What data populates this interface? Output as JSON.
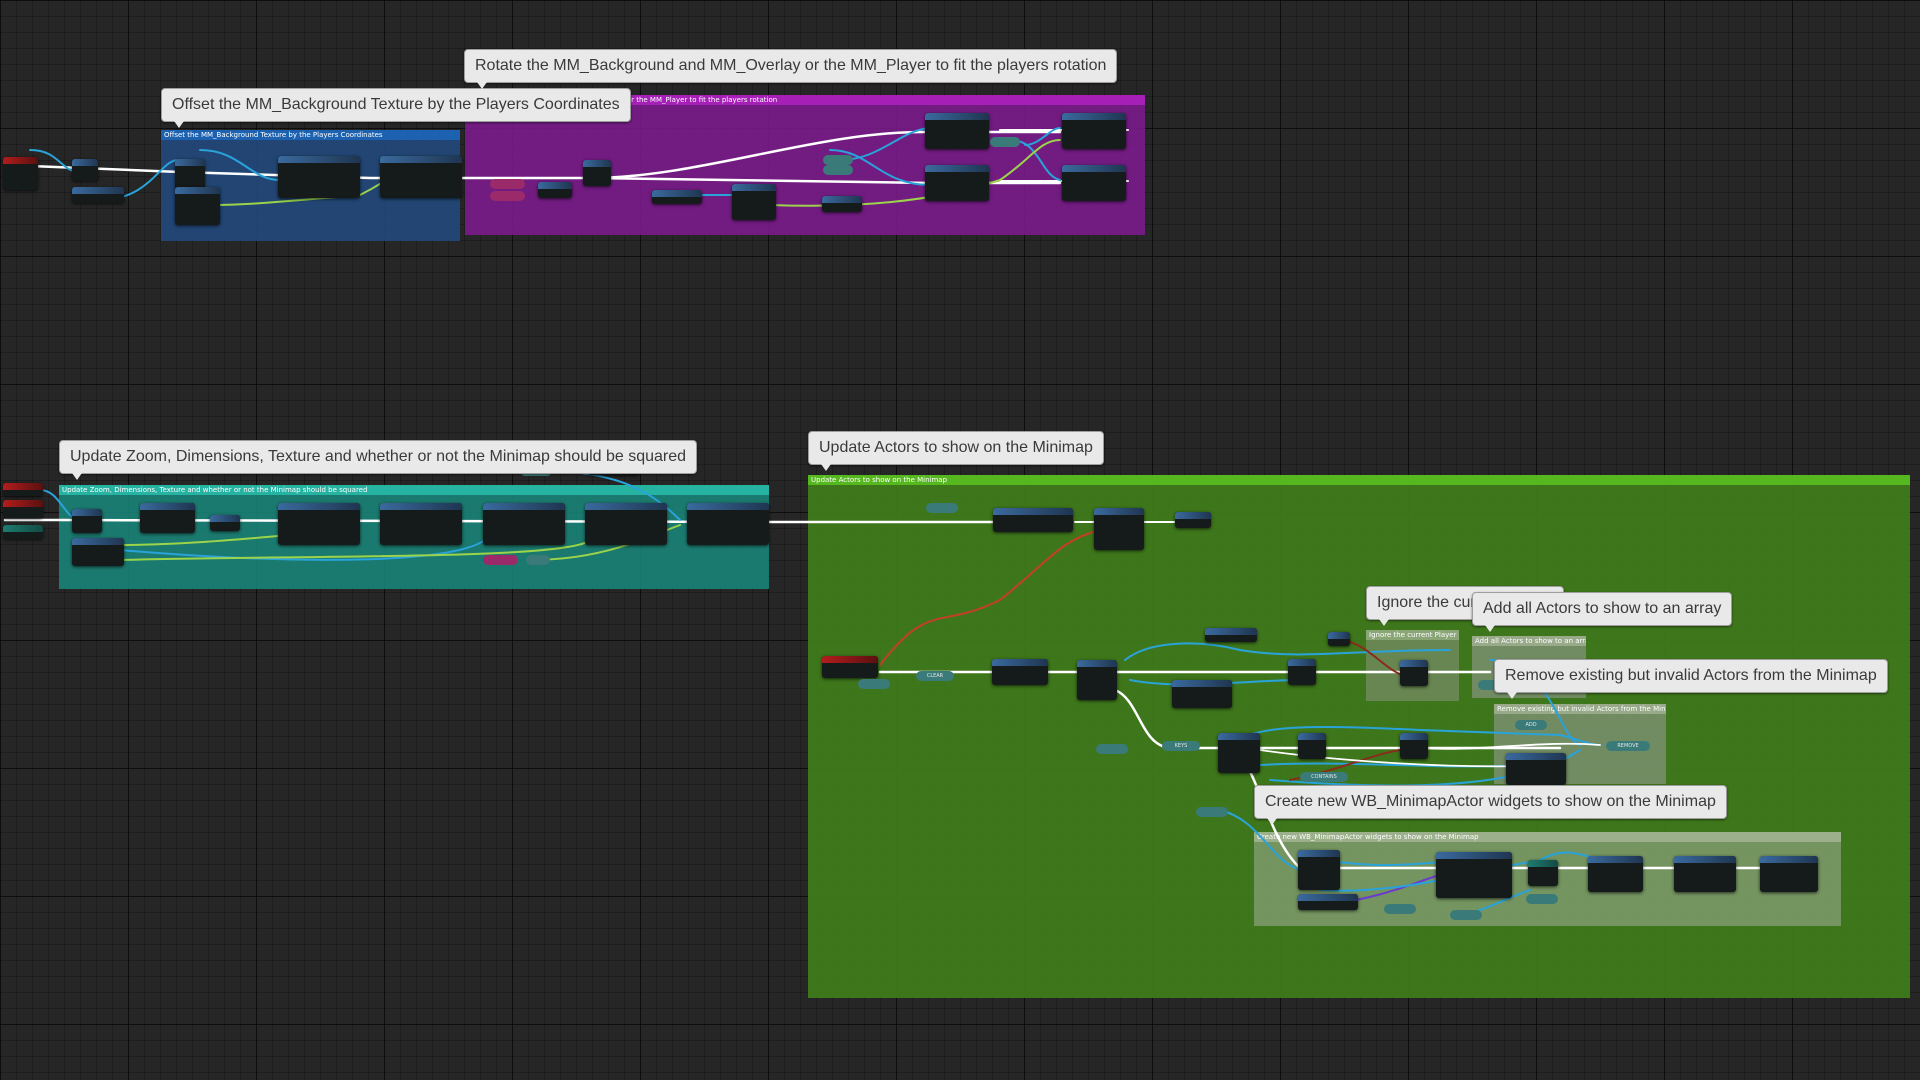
{
  "graph": {
    "comments": [
      {
        "id": "offset",
        "bubble": "Offset the MM_Background Texture by the Players Coordinates",
        "header": "Offset the MM_Background Texture by the Players Coordinates",
        "color": "#22487a"
      },
      {
        "id": "rotate",
        "bubble": "Rotate the MM_Background and MM_Overlay or the MM_Player to fit the players rotation",
        "header": "Rotate the MM_Background and MM_Overlay or the MM_Player to fit the players rotation",
        "color": "#7d1b8f"
      },
      {
        "id": "zoom",
        "bubble": "Update Zoom, Dimensions, Texture and whether or not the Minimap should be squared",
        "header": "Update Zoom, Dimensions, Texture and whether or not the Minimap should be squared",
        "color": "#1a8a7d"
      },
      {
        "id": "actors",
        "bubble": "Update Actors to show on the Minimap",
        "header": "Update Actors to show on the Minimap",
        "color": "#3f7a1a"
      },
      {
        "id": "ignore",
        "bubble": "Ignore the current Player",
        "header": "Ignore the current Player",
        "color": "#6f8a5a"
      },
      {
        "id": "add",
        "bubble": "Add all Actors to show to an array",
        "header": "Add all Actors to show to an array",
        "color": "#7a8f6e"
      },
      {
        "id": "remove",
        "bubble": "Remove existing but invalid Actors from the Minimap",
        "header": "Remove existing but invalid Actors from the Minimap",
        "color": "#7a8f6e"
      },
      {
        "id": "create",
        "bubble": "Create new WB_MinimapActor widgets to show on the Minimap",
        "header": "Create new WB_MinimapActor widgets to show on the Minimap",
        "color": "#7e9a6c"
      }
    ],
    "pills": [
      "CLEAR",
      "KEYS",
      "CONTAINS",
      "REMOVE",
      "ADD"
    ],
    "colors": {
      "exec_wire": "#ffffff",
      "object_wire": "#29a3d9",
      "float_wire": "#9bd44a",
      "bool_wire": "#8a2b1c",
      "struct_wire": "#6a3ad0"
    }
  }
}
